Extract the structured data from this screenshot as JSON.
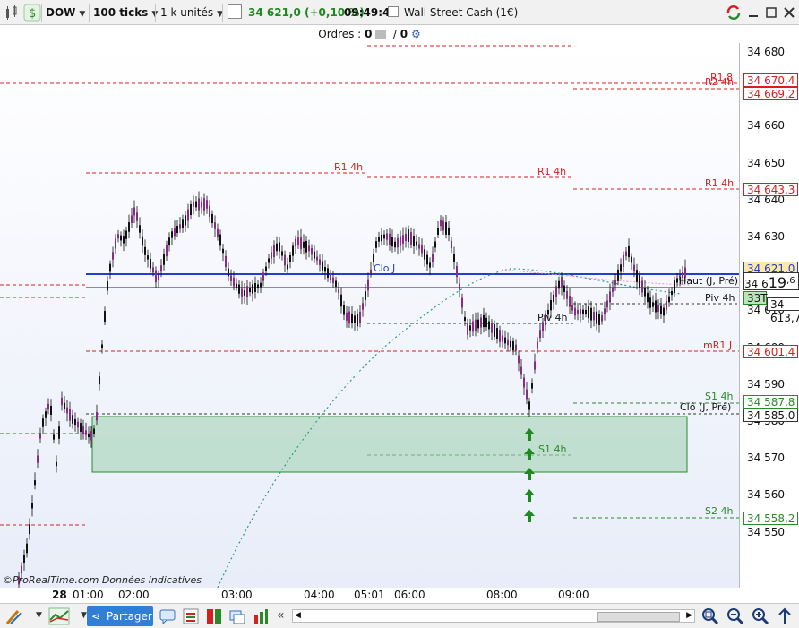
{
  "toolbar": {
    "instrument": "DOW",
    "ticks": "100 ticks",
    "units": "1 k unités",
    "price": "34 621,0 (+0,10 %)",
    "time": "09:49:40",
    "market": "Wall Street Cash (1€)"
  },
  "orders": {
    "label": "Ordres :",
    "left": "0",
    "right": "0"
  },
  "levels": {
    "r1_8": "R1,8",
    "r2_4h": "R2 4h",
    "r1_4h": "R1 4h",
    "clo_j": "Clo J",
    "haut_j_pre": "Haut (J, Pré)",
    "piv_4h": "Piv 4h",
    "mr1_j": "mR1 J",
    "s1_4h": "S1 4h",
    "clo_j_pre": "Clô (J, Pré)",
    "s2_4h": "S2 4h"
  },
  "yaxis": {
    "ticks": [
      "34 680",
      "34 670",
      "34 660",
      "34 650",
      "34 640",
      "34 630",
      "34 620",
      "34 610",
      "34 600",
      "34 590",
      "34 580",
      "34 570",
      "34 560",
      "34 550"
    ]
  },
  "price_tags": {
    "p1": "34 670,4",
    "p2": "34 669,2",
    "p3": "34 643,3",
    "p4": "34 621,0",
    "p5": "34 613,7",
    "p6": "34 601,4",
    "p7": "34 587,8",
    "p8": "34 585,0",
    "p9": "34 558,2",
    "live_main": "19",
    "live_dec": ",6",
    "live_prefix": "34 6",
    "live_count": "33T"
  },
  "xaxis": {
    "ticks": [
      "28",
      "01:00",
      "02:00",
      "03:00",
      "04:00",
      "05:01",
      "06:00",
      "08:00",
      "09:00"
    ]
  },
  "watermark": "©ProRealTime.com  Données indicatives",
  "bottom": {
    "share": "Partager"
  },
  "colors": {
    "resistance": "#d42020",
    "support": "#2a8a2a",
    "close_line": "#0033cc",
    "candle_up": "#8a2b8a"
  }
}
